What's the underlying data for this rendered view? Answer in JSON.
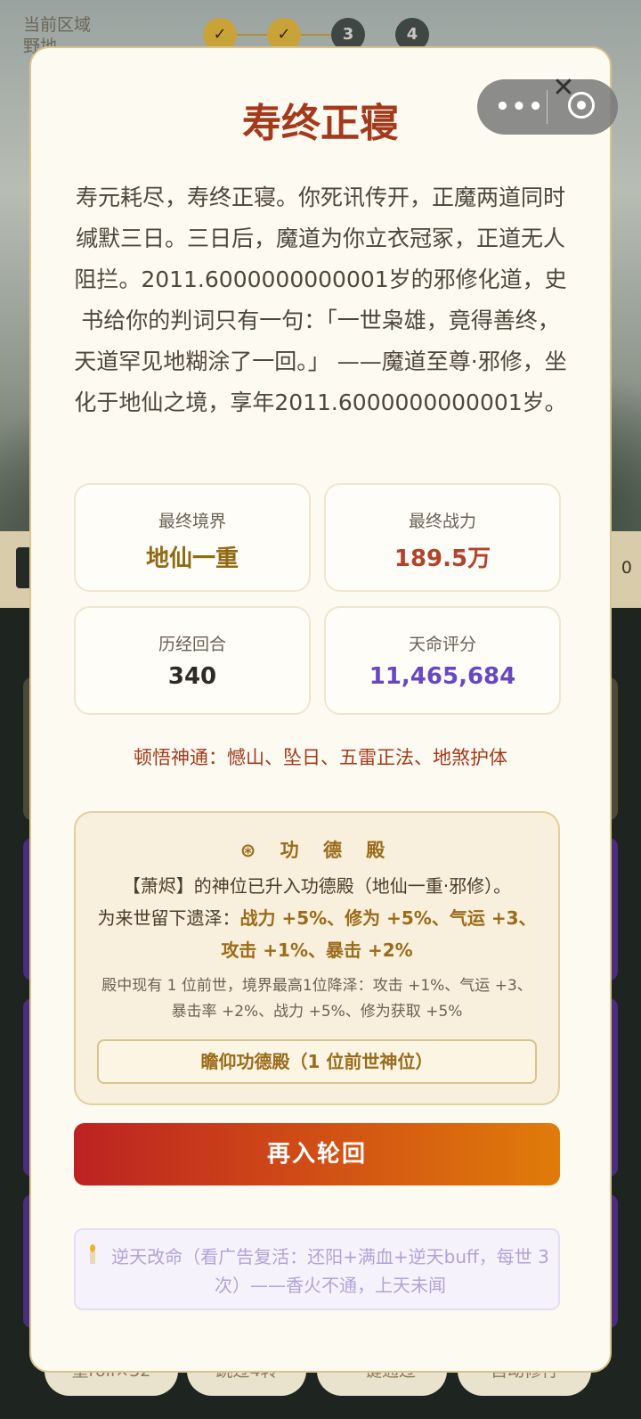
{
  "background": {
    "area_label": "当前区域",
    "area_sub": "野地",
    "steps": [
      "✓",
      "✓",
      "3",
      "4"
    ],
    "right_number": "0",
    "bottom_buttons": [
      "重roll×32",
      "跳过4转",
      "一键通过",
      "自动修行"
    ]
  },
  "capsule": {
    "more_glyph": "•••",
    "close_glyph": "✕"
  },
  "modal": {
    "title": "寿终正寝",
    "story": "寿元耗尽，寿终正寝。你死讯传开，正魔两道同时缄默三日。三日后，魔道为你立衣冠冢，正道无人阻拦。2011.6000000000001岁的邪修化道，史书给你的判词只有一句：「一世枭雄，竟得善终，天道罕见地糊涂了一回。」 ——魔道至尊·邪修，坐化于地仙之境，享年2011.6000000000001岁。",
    "stats": [
      {
        "label": "最终境界",
        "value": "地仙一重",
        "color": "#8f6a12"
      },
      {
        "label": "最终战力",
        "value": "189.5万",
        "color": "#b2432c"
      },
      {
        "label": "历经回合",
        "value": "340",
        "color": "#2e2a24"
      },
      {
        "label": "天命评分",
        "value": "11,465,684",
        "color": "#6848c2"
      }
    ],
    "skills": "顿悟神通：憾山、坠日、五雷正法、地煞护体",
    "merit": {
      "icon": "wheel-icon",
      "title": "⊛ 功 德 殿",
      "line1": "【萧烬】的神位已升入功德殿（地仙一重·邪修）。",
      "line2_prefix": "为来世留下遗泽：",
      "line2_bonus": "战力 +5%、修为 +5%、气运 +3、攻击 +1%、暴击 +2%",
      "sub": "殿中现有 1 位前世，境界最高1位降泽：攻击 +1%、气运 +3、暴击率 +2%、战力 +5%、修为获取 +5%",
      "button": "瞻仰功德殿（1 位前世神位）"
    },
    "rebirth_button": "再入轮回",
    "revive_text": "逆天改命（看广告复活：还阳+满血+逆天buff，每世 3 次）——香火不通，上天未闻"
  },
  "colors": {
    "title": "#a33a1c",
    "accent_gold": "#9a6c1a",
    "button_gradient_start": "#bc2222",
    "button_gradient_end": "#e07c0a",
    "score_purple": "#6848c2"
  }
}
